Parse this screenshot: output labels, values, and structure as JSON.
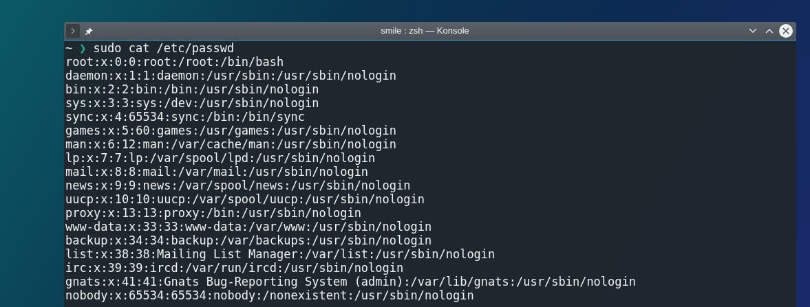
{
  "window": {
    "title": "smile : zsh — Konsole"
  },
  "terminal": {
    "prompt": {
      "path": "~",
      "symbol": "❯",
      "command": "sudo cat /etc/passwd"
    },
    "lines": [
      "root:x:0:0:root:/root:/bin/bash",
      "daemon:x:1:1:daemon:/usr/sbin:/usr/sbin/nologin",
      "bin:x:2:2:bin:/bin:/usr/sbin/nologin",
      "sys:x:3:3:sys:/dev:/usr/sbin/nologin",
      "sync:x:4:65534:sync:/bin:/bin/sync",
      "games:x:5:60:games:/usr/games:/usr/sbin/nologin",
      "man:x:6:12:man:/var/cache/man:/usr/sbin/nologin",
      "lp:x:7:7:lp:/var/spool/lpd:/usr/sbin/nologin",
      "mail:x:8:8:mail:/var/mail:/usr/sbin/nologin",
      "news:x:9:9:news:/var/spool/news:/usr/sbin/nologin",
      "uucp:x:10:10:uucp:/var/spool/uucp:/usr/sbin/nologin",
      "proxy:x:13:13:proxy:/bin:/usr/sbin/nologin",
      "www-data:x:33:33:www-data:/var/www:/usr/sbin/nologin",
      "backup:x:34:34:backup:/var/backups:/usr/sbin/nologin",
      "list:x:38:38:Mailing List Manager:/var/list:/usr/sbin/nologin",
      "irc:x:39:39:ircd:/var/run/ircd:/usr/sbin/nologin",
      "gnats:x:41:41:Gnats Bug-Reporting System (admin):/var/lib/gnats:/usr/sbin/nologin",
      "nobody:x:65534:65534:nobody:/nonexistent:/usr/sbin/nologin"
    ]
  }
}
